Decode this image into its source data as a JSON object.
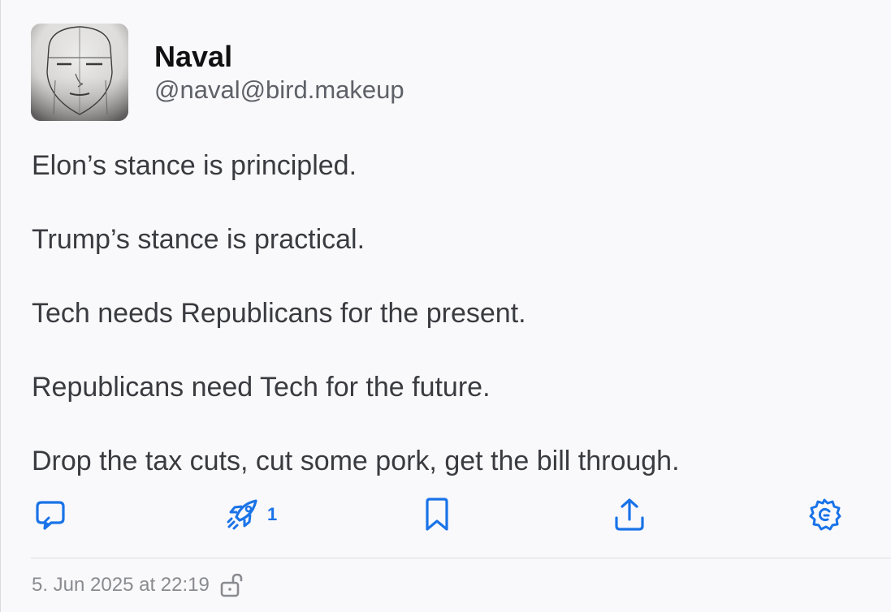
{
  "author": {
    "display_name": "Naval",
    "handle": "@naval@bird.makeup",
    "avatar_icon": "sketched-face-avatar"
  },
  "post": {
    "paragraphs": [
      "Elon’s stance is principled.",
      "Trump’s stance is practical.",
      "Tech needs Republicans for the present.",
      "Republicans need Tech for the future.",
      "Drop the tax cuts, cut some pork, get the bill through."
    ]
  },
  "actions": {
    "reply": {
      "icon": "reply-bubble-icon"
    },
    "boost": {
      "icon": "rocket-icon",
      "count": "1"
    },
    "bookmark": {
      "icon": "bookmark-icon"
    },
    "share": {
      "icon": "share-icon"
    },
    "more": {
      "icon": "gear-icon"
    }
  },
  "meta": {
    "timestamp": "5. Jun 2025 at 22:19",
    "visibility_icon": "unlocked-padlock-icon"
  },
  "colors": {
    "accent": "#1a73e8",
    "text": "#3a3b40",
    "muted": "#8a8b91",
    "background": "#f9f9fb"
  }
}
